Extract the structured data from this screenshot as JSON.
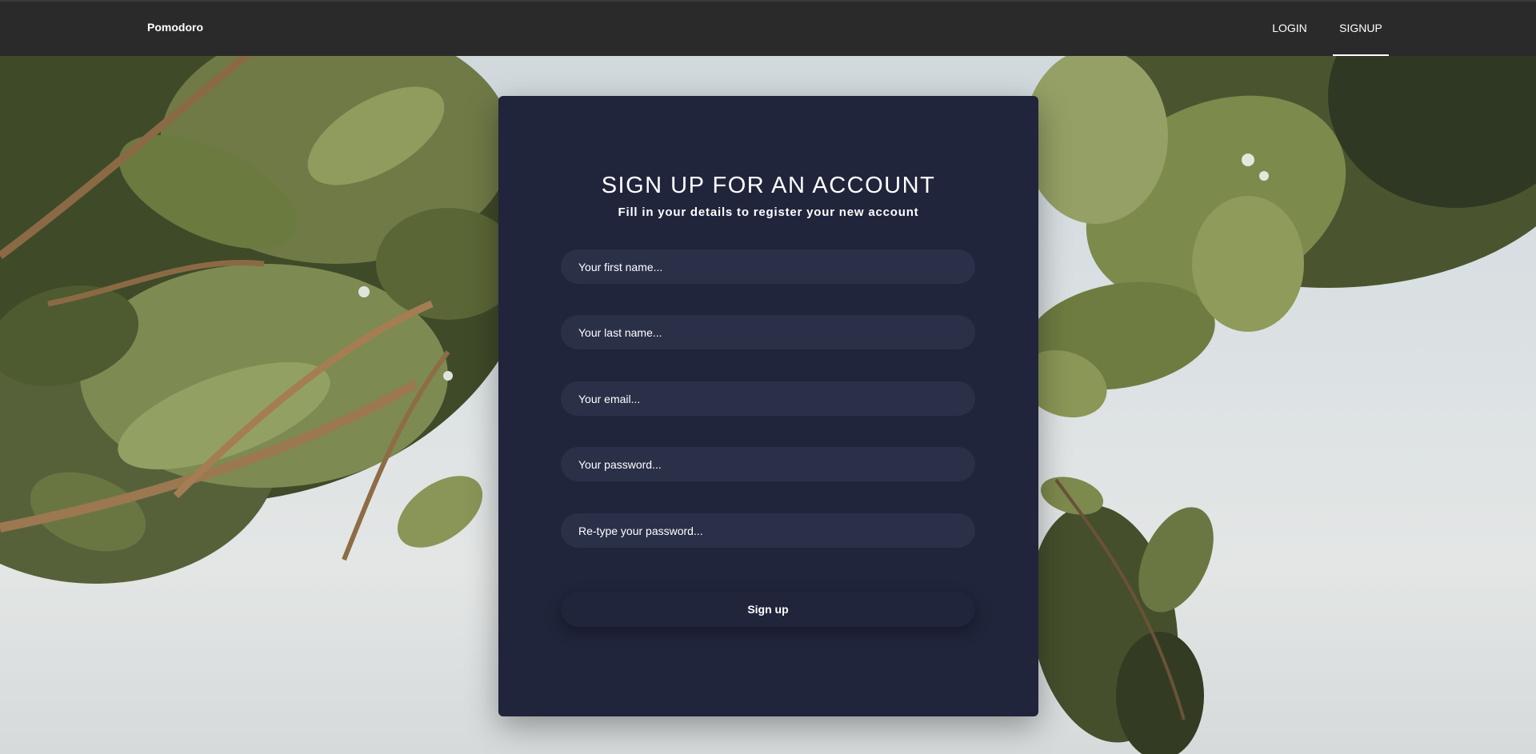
{
  "navbar": {
    "brand": "Pomodoro",
    "links": [
      {
        "label": "LOGIN",
        "active": false
      },
      {
        "label": "SIGNUP",
        "active": true
      }
    ]
  },
  "signup": {
    "title": "SIGN UP FOR AN ACCOUNT",
    "subtitle": "Fill in your details to register your new account",
    "fields": {
      "first_name": {
        "placeholder": "Your first name...",
        "value": ""
      },
      "last_name": {
        "placeholder": "Your last name...",
        "value": ""
      },
      "email": {
        "placeholder": "Your email...",
        "value": ""
      },
      "password": {
        "placeholder": "Your password...",
        "value": ""
      },
      "confirm_password": {
        "placeholder": "Re-type your password...",
        "value": ""
      }
    },
    "submit_label": "Sign up"
  },
  "colors": {
    "navbar_bg": "#2a2a2a",
    "card_bg": "#20253c",
    "input_bg": "#2a3048",
    "text": "#ffffff"
  }
}
